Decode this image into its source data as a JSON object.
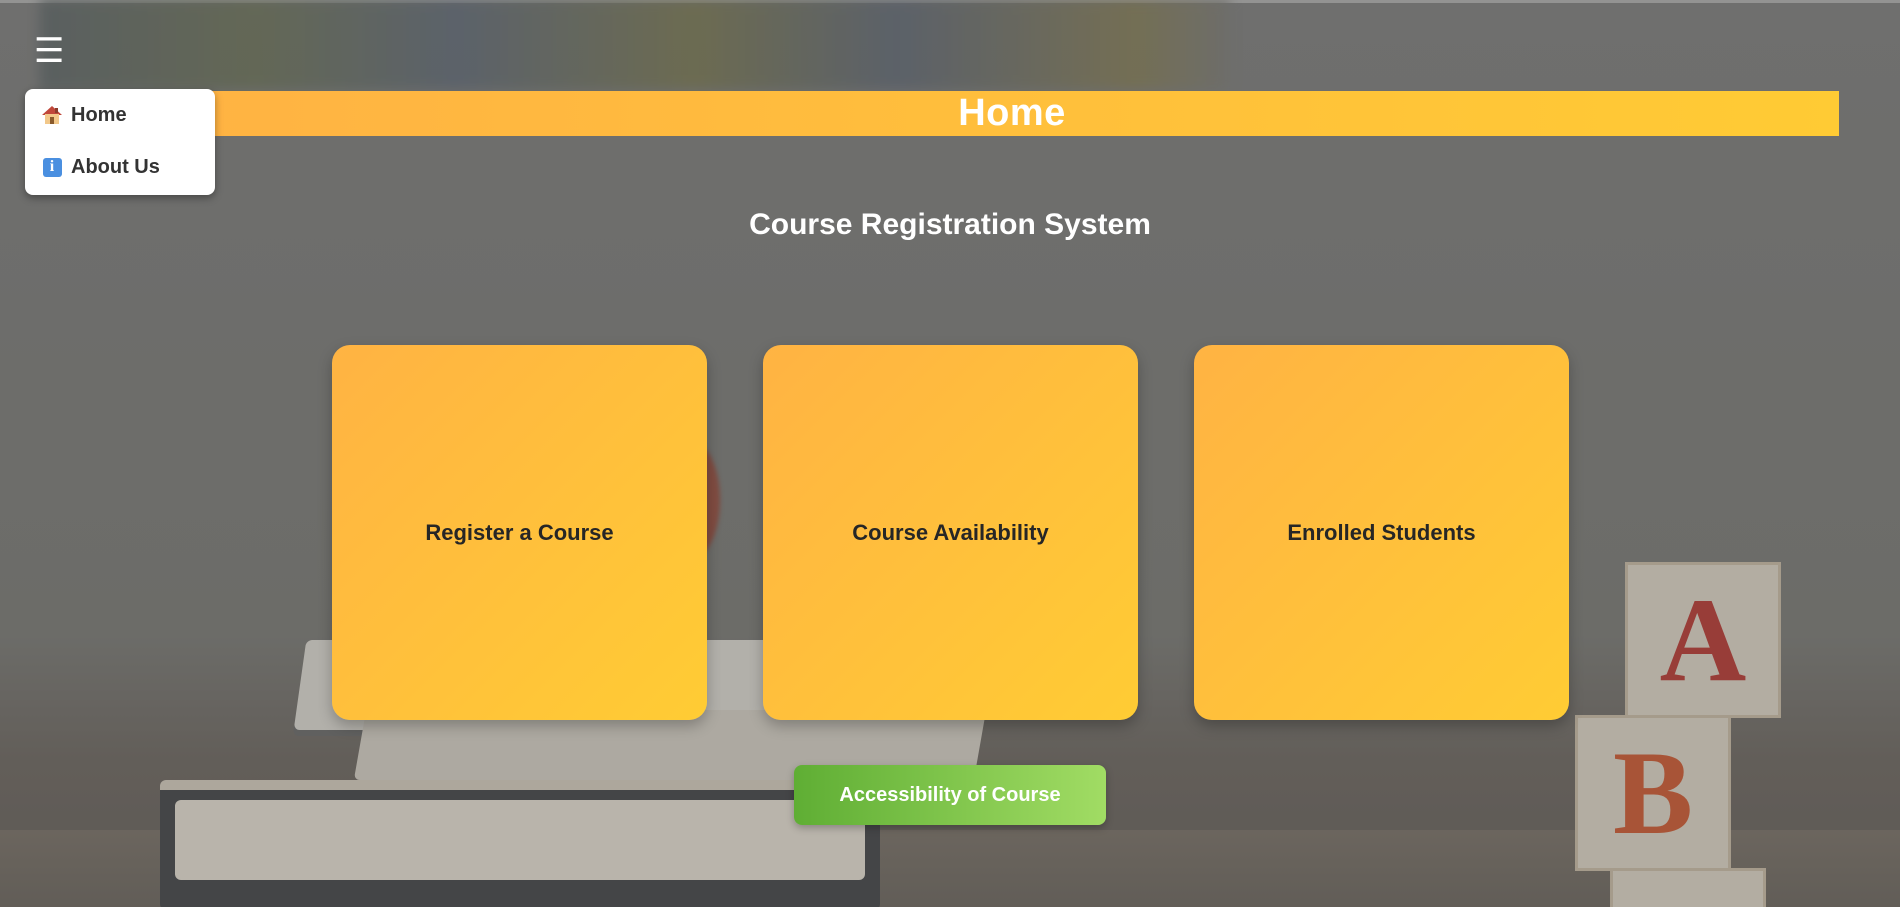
{
  "nav": {
    "menu_toggle_glyph": "☰",
    "items": [
      {
        "icon": "house-icon",
        "label": "Home"
      },
      {
        "icon": "info-icon",
        "label": "About Us"
      }
    ]
  },
  "header": {
    "title": "Home"
  },
  "main": {
    "subtitle": "Course Registration System",
    "cards": [
      {
        "label": "Register a Course"
      },
      {
        "label": "Course Availability"
      },
      {
        "label": "Enrolled Students"
      }
    ],
    "accessibility_button": "Accessibility of Course"
  },
  "colors": {
    "card_gradient_start": "#ffb343",
    "card_gradient_end": "#ffcc34",
    "button_gradient_start": "#5fae34",
    "button_gradient_end": "#a1dc64"
  }
}
